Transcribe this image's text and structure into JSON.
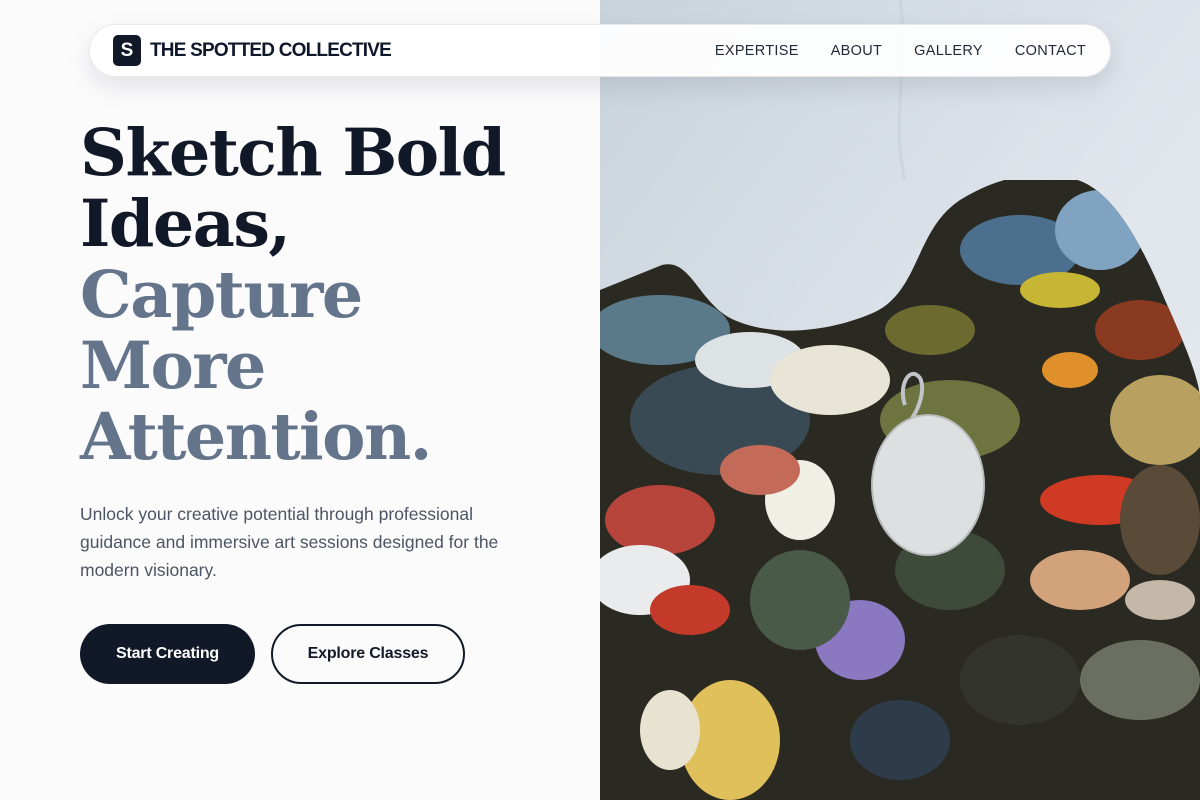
{
  "brand": {
    "mark": "S",
    "name": "THE SPOTTED COLLECTIVE"
  },
  "nav": {
    "items": [
      {
        "label": "EXPERTISE"
      },
      {
        "label": "ABOUT"
      },
      {
        "label": "GALLERY"
      },
      {
        "label": "CONTACT"
      }
    ]
  },
  "hero": {
    "headline": {
      "line1": "Sketch Bold",
      "line2": "Ideas,",
      "line3": "Capture",
      "line4": "More",
      "line5": "Attention."
    },
    "subtitle": "Unlock your creative potential through professional guidance and immersive art sessions designed for the modern visionary.",
    "primary_button": "Start Creating",
    "secondary_button": "Explore Classes"
  },
  "colors": {
    "dark": "#111827",
    "muted_heading": "#64748b",
    "body_text": "#4b5563",
    "page_background": "#fbfbfc"
  },
  "icons": {
    "palette_image": "paint-palette-photo"
  }
}
